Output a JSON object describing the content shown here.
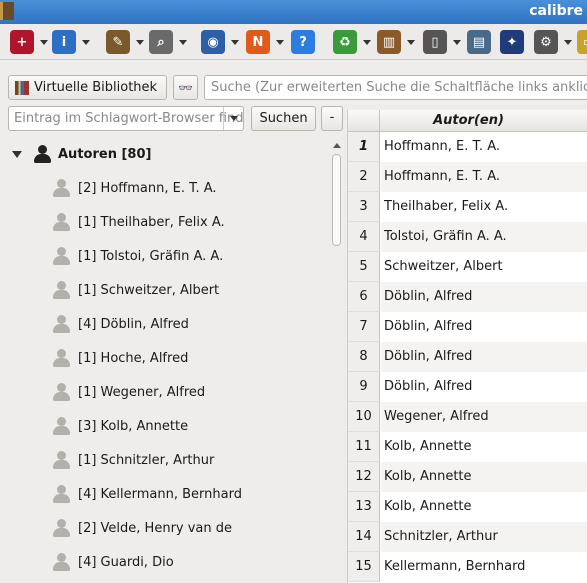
{
  "window": {
    "title": "calibre"
  },
  "toolbar": {
    "items": [
      {
        "icon": "add-books-icon",
        "color": "#b0152e",
        "glyph": "+"
      },
      {
        "icon": "info-icon",
        "color": "#2d6fc4",
        "glyph": "i"
      },
      {
        "icon": "edit-metadata-icon",
        "color": "#7a5a2a",
        "glyph": "✎"
      },
      {
        "icon": "find-icon",
        "color": "#6a6a6a",
        "glyph": "⌕"
      },
      {
        "icon": "get-books-icon",
        "color": "#2c5fa6",
        "glyph": "◉"
      },
      {
        "icon": "news-icon",
        "color": "#e05a1a",
        "glyph": "N"
      },
      {
        "icon": "help-icon",
        "color": "#2d7de0",
        "glyph": "?"
      },
      {
        "icon": "recycle-icon",
        "color": "#3a9b3a",
        "glyph": "♻"
      },
      {
        "icon": "library-icon",
        "color": "#8a5a2a",
        "glyph": "▥"
      },
      {
        "icon": "device-icon",
        "color": "#555555",
        "glyph": "▯"
      },
      {
        "icon": "save-icon",
        "color": "#4a6a8a",
        "glyph": "▤"
      },
      {
        "icon": "ebook-viewer-icon",
        "color": "#1f3b7a",
        "glyph": "✦"
      },
      {
        "icon": "preferences-icon",
        "color": "#555555",
        "glyph": "⚙"
      },
      {
        "icon": "tweak-icon",
        "color": "#c9a227",
        "glyph": "▭"
      }
    ]
  },
  "search": {
    "virtual_library_label": "Virtuelle Bibliothek",
    "main_placeholder": "Suche (Zur erweiterten Suche die Schaltfläche links anklicken)",
    "tag_browser_placeholder": "Eintrag im Schlagwort-Browser finden",
    "search_button": "Suchen",
    "minus_button": "-"
  },
  "tag_browser": {
    "root_label": "Autoren [80]",
    "items": [
      "[2] Hoffmann, E. T. A.",
      "[1] Theilhaber, Felix A.",
      "[1] Tolstoi, Gräfin A. A.",
      "[1] Schweitzer, Albert",
      "[4] Döblin, Alfred",
      "[1] Hoche, Alfred",
      "[1] Wegener, Alfred",
      "[3] Kolb, Annette",
      "[1] Schnitzler, Arthur",
      "[4] Kellermann, Bernhard",
      "[2] Velde, Henry van de",
      "[4] Guardi, Dio"
    ]
  },
  "book_list": {
    "column_header": "Autor(en)",
    "rows": [
      {
        "num": "1",
        "author": "Hoffmann, E. T. A."
      },
      {
        "num": "2",
        "author": "Hoffmann, E. T. A."
      },
      {
        "num": "3",
        "author": "Theilhaber, Felix A."
      },
      {
        "num": "4",
        "author": "Tolstoi, Gräfin A. A."
      },
      {
        "num": "5",
        "author": "Schweitzer, Albert"
      },
      {
        "num": "6",
        "author": "Döblin, Alfred"
      },
      {
        "num": "7",
        "author": "Döblin, Alfred"
      },
      {
        "num": "8",
        "author": "Döblin, Alfred"
      },
      {
        "num": "9",
        "author": "Döblin, Alfred"
      },
      {
        "num": "10",
        "author": "Wegener, Alfred"
      },
      {
        "num": "11",
        "author": "Kolb, Annette"
      },
      {
        "num": "12",
        "author": "Kolb, Annette"
      },
      {
        "num": "13",
        "author": "Kolb, Annette"
      },
      {
        "num": "14",
        "author": "Schnitzler, Arthur"
      },
      {
        "num": "15",
        "author": "Kellermann, Bernhard"
      }
    ]
  }
}
